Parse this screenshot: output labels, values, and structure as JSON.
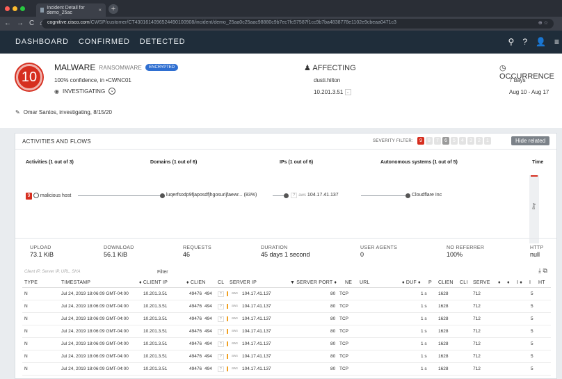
{
  "browser": {
    "tab_title": "Incident Detail for demo_25ac",
    "url_host": "cognitive.cisco.com",
    "url_path": "/CWSP/customer/CT4301614096524490100908/incident/demo_25aa0c25aac98880c9b7ec7fc57587f1cc9b7ba4838778e1102e9cbeaa0471c3"
  },
  "nav": {
    "links": [
      "DASHBOARD",
      "CONFIRMED",
      "DETECTED"
    ]
  },
  "header": {
    "severity": "10",
    "threat": "MALWARE",
    "category": "RANSOMWARE",
    "encrypted_pill": "ENCRYPTED",
    "confidence": "100% confidence, in",
    "customer": "•CWNC01",
    "status": "INVESTIGATING",
    "note": "Omar Santos, investigating, 8/15/20",
    "affecting_title": "AFFECTING",
    "affecting_user": "dusti.hilton",
    "affecting_ip": "10.201.3.51",
    "occurrence_title": "OCCURRENCE",
    "occurrence_duration": "7 days",
    "occurrence_range": "Aug 10 - Aug 17"
  },
  "activities": {
    "title": "ACTIVITIES AND FLOWS",
    "severity_filter_label": "SEVERITY FILTER:",
    "severity_levels": [
      "9",
      "8",
      "7",
      "6",
      "5",
      "4",
      "3",
      "2",
      "1"
    ],
    "hide_button": "Hide related",
    "columns": [
      "Activities (1 out of 3)",
      "Domains (1 out of 6)",
      "IPs (1 out of 6)",
      "Autonomous systems (1 out of 5)",
      "Time"
    ],
    "flow": {
      "activity_badge": "9",
      "activity": "malicious host",
      "domain": "luqerfsodp9fjaposdfjhgosurijfaewr... (83%)",
      "ip_chip": "?",
      "ip_aws": "aws",
      "ip": "104.17.41.137",
      "as": "Cloudflare Inc",
      "time_label": "Aug"
    }
  },
  "stats": [
    {
      "k": "UPLOAD",
      "v": "73.1 KiB"
    },
    {
      "k": "DOWNLOAD",
      "v": "56.1 KiB"
    },
    {
      "k": "REQUESTS",
      "v": "46"
    },
    {
      "k": "DURATION",
      "v": "45 days 1 second"
    },
    {
      "k": "USER AGENTS",
      "v": "0"
    },
    {
      "k": "NO REFERRER",
      "v": "100%"
    },
    {
      "k": "HTTP",
      "v": "null"
    }
  ],
  "table": {
    "filter_placeholder": "Client IP, Server IP, URL, SHA",
    "filter_label": "Filter",
    "headers": [
      "TYPE",
      "TIMESTAMP",
      "♦ CLIENT IP",
      "♦ CLIEN",
      "CL",
      "SERVER IP",
      "▼ SERVER PORT ♦",
      "NE",
      "URL",
      "♦ DUF ♦",
      "P",
      "CLIEN",
      "CLI",
      "SERVE",
      "♦",
      "♦",
      "I ♦",
      "I",
      "HT"
    ],
    "rows": [
      {
        "type": "N",
        "ts": "Jul 24, 2019 18:06:09 GMT-04:00",
        "cip": "10.201.3.51",
        "cport": "49476",
        "cl": "494",
        "chip": "?",
        "aws": "aws",
        "sip": "104.17.41.137",
        "sport": "80",
        "ne": "TCP",
        "dur": "1 s",
        "clien": "1628",
        "serve": "712",
        "last": "5"
      },
      {
        "type": "N",
        "ts": "Jul 24, 2019 18:06:09 GMT-04:00",
        "cip": "10.201.3.51",
        "cport": "49476",
        "cl": "494",
        "chip": "?",
        "aws": "aws",
        "sip": "104.17.41.137",
        "sport": "80",
        "ne": "TCP",
        "dur": "1 s",
        "clien": "1628",
        "serve": "712",
        "last": "5"
      },
      {
        "type": "N",
        "ts": "Jul 24, 2019 18:06:09 GMT-04:00",
        "cip": "10.201.3.51",
        "cport": "49476",
        "cl": "494",
        "chip": "?",
        "aws": "aws",
        "sip": "104.17.41.137",
        "sport": "80",
        "ne": "TCP",
        "dur": "1 s",
        "clien": "1628",
        "serve": "712",
        "last": "5"
      },
      {
        "type": "N",
        "ts": "Jul 24, 2019 18:06:09 GMT-04:00",
        "cip": "10.201.3.51",
        "cport": "49476",
        "cl": "494",
        "chip": "?",
        "aws": "aws",
        "sip": "104.17.41.137",
        "sport": "80",
        "ne": "TCP",
        "dur": "1 s",
        "clien": "1628",
        "serve": "712",
        "last": "5"
      },
      {
        "type": "N",
        "ts": "Jul 24, 2019 18:06:09 GMT-04:00",
        "cip": "10.201.3.51",
        "cport": "49476",
        "cl": "494",
        "chip": "?",
        "aws": "aws",
        "sip": "104.17.41.137",
        "sport": "80",
        "ne": "TCP",
        "dur": "1 s",
        "clien": "1628",
        "serve": "712",
        "last": "5"
      },
      {
        "type": "N",
        "ts": "Jul 24, 2019 18:06:09 GMT-04:00",
        "cip": "10.201.3.51",
        "cport": "49476",
        "cl": "494",
        "chip": "?",
        "aws": "aws",
        "sip": "104.17.41.137",
        "sport": "80",
        "ne": "TCP",
        "dur": "1 s",
        "clien": "1628",
        "serve": "712",
        "last": "5"
      },
      {
        "type": "N",
        "ts": "Jul 24, 2019 18:06:09 GMT-04:00",
        "cip": "10.201.3.51",
        "cport": "49476",
        "cl": "494",
        "chip": "?",
        "aws": "aws",
        "sip": "104.17.41.137",
        "sport": "80",
        "ne": "TCP",
        "dur": "1 s",
        "clien": "1628",
        "serve": "712",
        "last": "5"
      }
    ]
  },
  "colors": {
    "nav_bg": "#1f2d3a",
    "severity_red": "#d62e1f",
    "pill_blue": "#2f6fd1",
    "panel_bg": "#e9ecef"
  }
}
